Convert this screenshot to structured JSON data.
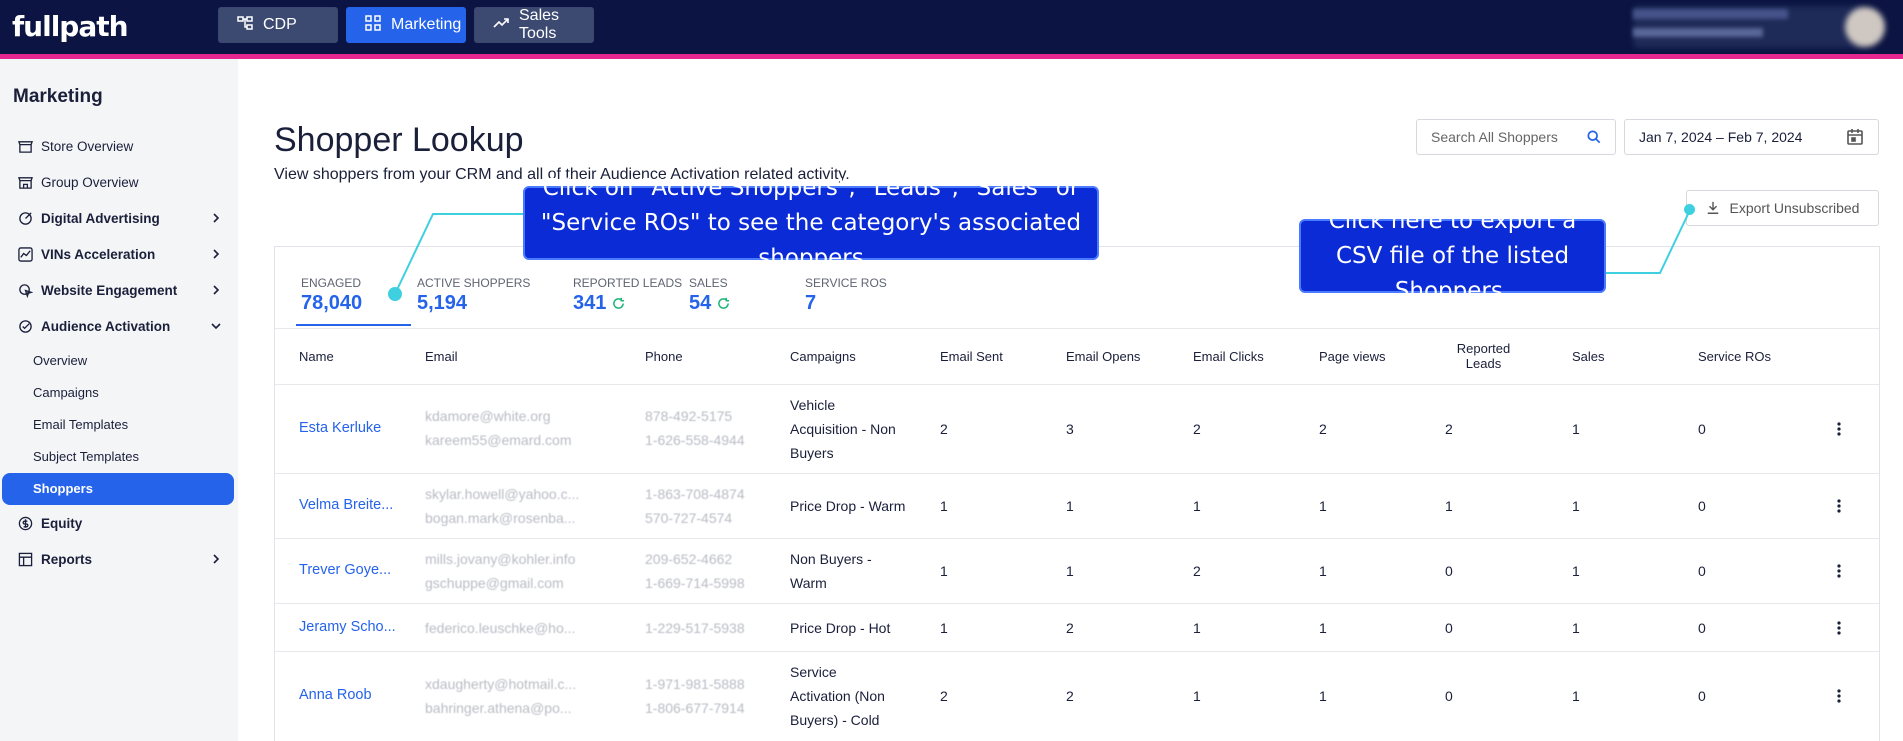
{
  "topbar": {
    "logo": "fullpath",
    "nav": [
      {
        "label": "CDP",
        "icon": "tree-icon"
      },
      {
        "label": "Marketing",
        "icon": "grid-icon"
      },
      {
        "label": "Sales Tools",
        "icon": "trend-up-icon"
      }
    ]
  },
  "sidebar": {
    "title": "Marketing",
    "items": [
      {
        "label": "Store Overview",
        "icon": "store-icon"
      },
      {
        "label": "Group Overview",
        "icon": "store-icon"
      },
      {
        "label": "Digital Advertising",
        "icon": "target-icon"
      },
      {
        "label": "VINs Acceleration",
        "icon": "chart-icon"
      },
      {
        "label": "Website Engagement",
        "icon": "cursor-icon"
      },
      {
        "label": "Audience Activation",
        "icon": "check-circle-icon"
      },
      {
        "label": "Equity",
        "icon": "dollar-icon"
      },
      {
        "label": "Reports",
        "icon": "table-icon"
      }
    ],
    "sub_items": [
      "Overview",
      "Campaigns",
      "Email Templates",
      "Subject Templates",
      "Shoppers"
    ]
  },
  "page": {
    "title": "Shopper Lookup",
    "subtitle": "View shoppers from your CRM and all of their Audience Activation related activity.",
    "search_placeholder": "Search All Shoppers",
    "date_range": "Jan 7, 2024 – Feb 7, 2024",
    "export_label": "Export Unsubscribed"
  },
  "stats": [
    {
      "label": "ENGAGED",
      "value": "78,040"
    },
    {
      "label": "ACTIVE SHOPPERS",
      "value": "5,194"
    },
    {
      "label": "REPORTED LEADS",
      "value": "341"
    },
    {
      "label": "SALES",
      "value": "54"
    },
    {
      "label": "SERVICE ROS",
      "value": "7"
    }
  ],
  "table": {
    "headers": [
      "Name",
      "Email",
      "Phone",
      "Campaigns",
      "Email Sent",
      "Email Opens",
      "Email Clicks",
      "Page views",
      "Reported Leads",
      "Sales",
      "Service ROs"
    ],
    "rows": [
      {
        "name": "Esta Kerluke",
        "emails": [
          "kdamore@white.org",
          "kareem55@emard.com"
        ],
        "phones": [
          "878-492-5175",
          "1-626-558-4944"
        ],
        "campaign": [
          "Vehicle",
          "Acquisition - Non",
          "Buyers"
        ],
        "sent": "2",
        "opens": "3",
        "clicks": "2",
        "views": "2",
        "leads": "2",
        "sales": "1",
        "ros": "0"
      },
      {
        "name": "Velma Breite...",
        "emails": [
          "skylar.howell@yahoo.c...",
          "bogan.mark@rosenba..."
        ],
        "phones": [
          "1-863-708-4874",
          "570-727-4574"
        ],
        "campaign": [
          "Price Drop - Warm"
        ],
        "sent": "1",
        "opens": "1",
        "clicks": "1",
        "views": "1",
        "leads": "1",
        "sales": "1",
        "ros": "0"
      },
      {
        "name": "Trever Goye...",
        "emails": [
          "mills.jovany@kohler.info",
          "gschuppe@gmail.com"
        ],
        "phones": [
          "209-652-4662",
          "1-669-714-5998"
        ],
        "campaign": [
          "Non Buyers -",
          "Warm"
        ],
        "sent": "1",
        "opens": "1",
        "clicks": "2",
        "views": "1",
        "leads": "0",
        "sales": "1",
        "ros": "0"
      },
      {
        "name": "Jeramy Scho...",
        "emails": [
          "federico.leuschke@ho..."
        ],
        "phones": [
          "1-229-517-5938"
        ],
        "campaign": [
          "Price Drop - Hot"
        ],
        "sent": "1",
        "opens": "2",
        "clicks": "1",
        "views": "1",
        "leads": "0",
        "sales": "1",
        "ros": "0"
      },
      {
        "name": "Anna Roob",
        "emails": [
          "xdaugherty@hotmail.c...",
          "bahringer.athena@po..."
        ],
        "phones": [
          "1-971-981-5888",
          "1-806-677-7914"
        ],
        "campaign": [
          "Service",
          "Activation (Non",
          "Buyers) - Cold"
        ],
        "sent": "2",
        "opens": "2",
        "clicks": "1",
        "views": "1",
        "leads": "0",
        "sales": "1",
        "ros": "0"
      }
    ]
  },
  "callouts": {
    "left": "Click on \"Active Shoppers\", \"Leads\", \"Sales\" or \"Service ROs\" to see the category's associated shoppers",
    "right": "Click here to export a CSV file of the listed Shoppers."
  },
  "colors": {
    "topbar": "#0b1442",
    "accent": "#e7268f",
    "primary": "#2563eb",
    "callout": "#0b2bd6",
    "connector": "#3fd0e0"
  }
}
